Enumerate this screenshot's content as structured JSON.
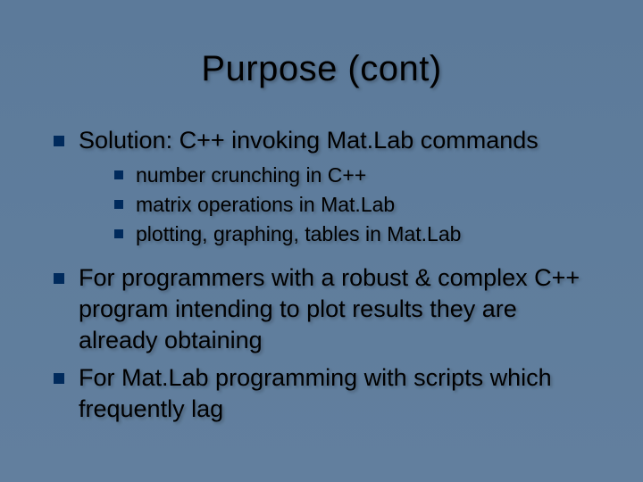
{
  "title": "Purpose (cont)",
  "bullets": [
    {
      "text": "Solution: C++ invoking Mat.Lab commands",
      "sub": [
        "number crunching in C++",
        "matrix operations in Mat.Lab",
        "plotting, graphing, tables in Mat.Lab"
      ]
    },
    {
      "text": "For programmers with a robust & complex C++ program intending to plot results they are already obtaining",
      "sub": []
    },
    {
      "text": "For Mat.Lab programming with scripts which frequently lag",
      "sub": []
    }
  ]
}
